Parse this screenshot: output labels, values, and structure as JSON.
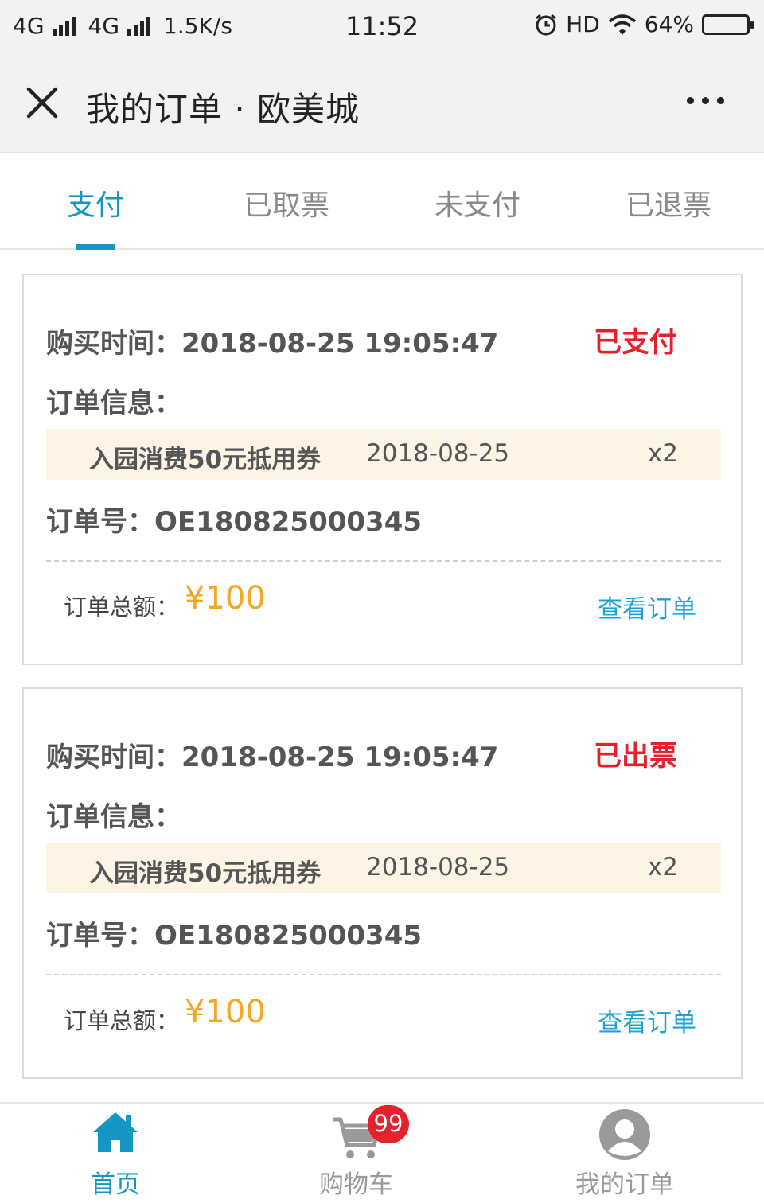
{
  "status_bar": {
    "network1": "4G",
    "network2": "4G",
    "speed": "1.5K/s",
    "time": "11:52",
    "hd_label": "HD",
    "battery": "64%",
    "battery_level": 0.64
  },
  "nav": {
    "title": "我的订单 · 欧美城",
    "close_icon": "close-icon",
    "more_icon": "more-icon"
  },
  "tabs": [
    {
      "label": "支付",
      "active": true
    },
    {
      "label": "已取票",
      "active": false
    },
    {
      "label": "未支付",
      "active": false
    },
    {
      "label": "已退票",
      "active": false
    }
  ],
  "orders": [
    {
      "purchase_time": "购买时间：2018-08-25 19:05:47",
      "status": "已支付",
      "info_label": "订单信息：",
      "item_name": "入园消费50元抵用券",
      "item_date": "2018-08-25",
      "item_qty": "x2",
      "order_no": "订单号：OE180825000345",
      "total_label": "订单总额：",
      "total_value": "¥100",
      "view_label": "查看订单"
    },
    {
      "purchase_time": "购买时间：2018-08-25 19:05:47",
      "status": "已出票",
      "info_label": "订单信息：",
      "item_name": "入园消费50元抵用券",
      "item_date": "2018-08-25",
      "item_qty": "x2",
      "order_no": "订单号：OE180825000345",
      "total_label": "订单总额：",
      "total_value": "¥100",
      "view_label": "查看订单"
    }
  ],
  "bottom_nav": [
    {
      "label": "首页",
      "icon": "home-icon",
      "active": true
    },
    {
      "label": "购物车",
      "icon": "cart-icon",
      "badge": "99",
      "active": false
    },
    {
      "label": "我的订单",
      "icon": "user-icon",
      "active": false
    }
  ],
  "colors": {
    "accent": "#1597c6",
    "status_red": "#e5212d",
    "price_orange": "#f5a623",
    "link_blue": "#1ba3d6",
    "item_bg": "#fdf4e6"
  }
}
